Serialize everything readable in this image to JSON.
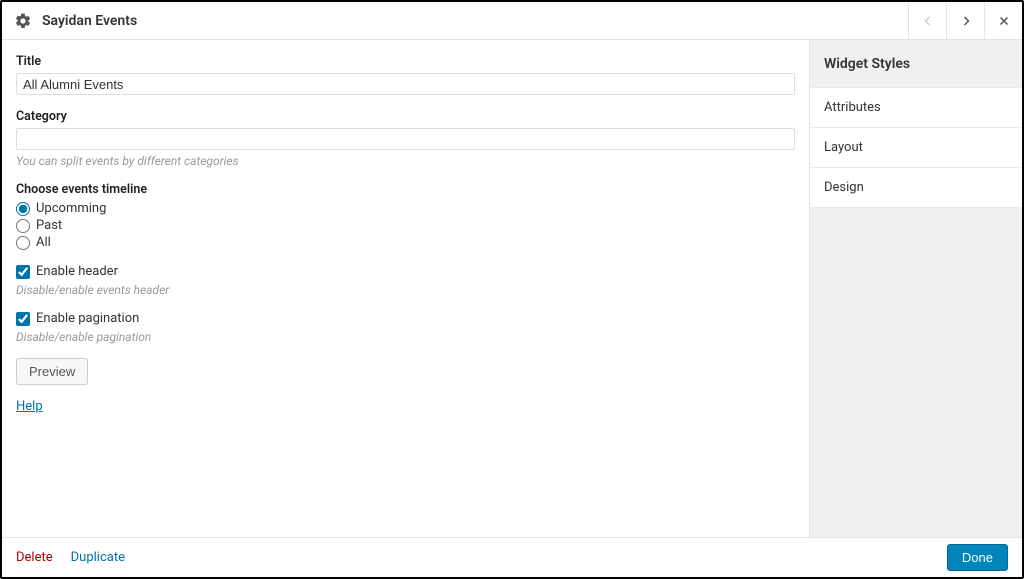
{
  "header": {
    "title": "Sayidan Events"
  },
  "form": {
    "title_label": "Title",
    "title_value": "All Alumni Events",
    "category_label": "Category",
    "category_value": "",
    "category_helper": "You can split events by different categories",
    "timeline_label": "Choose events timeline",
    "timeline_options": {
      "upcoming": "Upcomming",
      "past": "Past",
      "all": "All"
    },
    "header_checkbox_label": "Enable header",
    "header_checkbox_helper": "Disable/enable events header",
    "pagination_checkbox_label": "Enable pagination",
    "pagination_checkbox_helper": "Disable/enable pagination",
    "preview_button": "Preview",
    "help_link": "Help"
  },
  "sidebar": {
    "title": "Widget Styles",
    "items": {
      "attributes": "Attributes",
      "layout": "Layout",
      "design": "Design"
    }
  },
  "footer": {
    "delete": "Delete",
    "duplicate": "Duplicate",
    "done": "Done"
  }
}
